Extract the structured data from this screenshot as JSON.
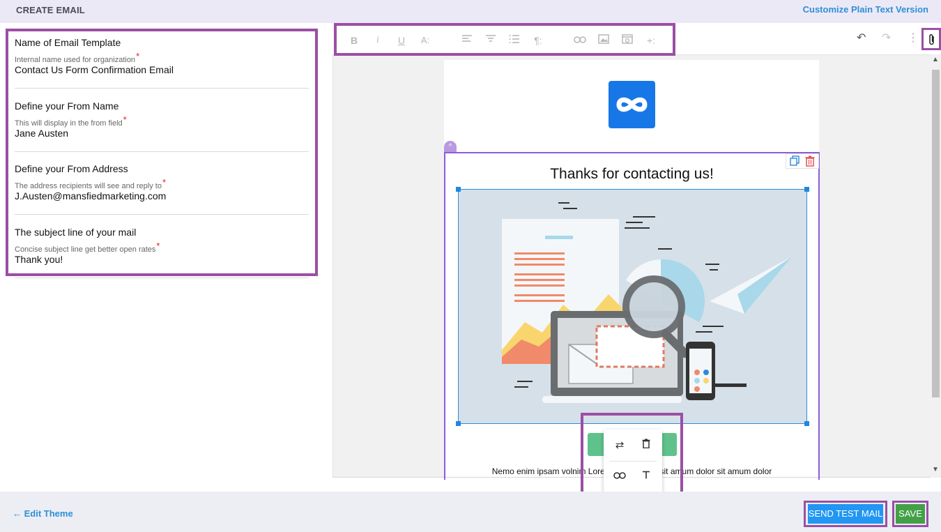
{
  "header": {
    "title": "CREATE EMAIL",
    "plain_text_link": "Customize Plain Text Version"
  },
  "form": {
    "fields": [
      {
        "label": "Name of Email Template",
        "hint": "Internal name used for organization",
        "required": "*",
        "value": "Contact Us Form Confirmation Email"
      },
      {
        "label": "Define your From Name",
        "hint": "This will display in the from field",
        "required": "*",
        "value": "Jane Austen"
      },
      {
        "label": "Define your From Address",
        "hint": "The address recipients will see and reply to",
        "required": "*",
        "value": "J.Austen@mansfiedmarketing.com"
      },
      {
        "label": "The subject line of your mail",
        "hint": "Concise subject line get better open rates",
        "required": "*",
        "value": "Thank you!"
      }
    ]
  },
  "toolbar": {
    "bold": "B",
    "italic": "i",
    "underline": "U",
    "font_size": "A:",
    "insert_more": "+:"
  },
  "email": {
    "heading": "Thanks for contacting us!",
    "body_text": "Nemo enim ipsam volnim Lorem ipsum dolor sit amum dolor sit amum dolor"
  },
  "footer": {
    "edit_theme": "← Edit Theme",
    "send_test_mail": "SEND TEST MAIL",
    "save": "SAVE"
  },
  "colors": {
    "accent": "#9b4fa5",
    "primary": "#2196f3",
    "success": "#43a047",
    "link": "#2d8fd5"
  }
}
